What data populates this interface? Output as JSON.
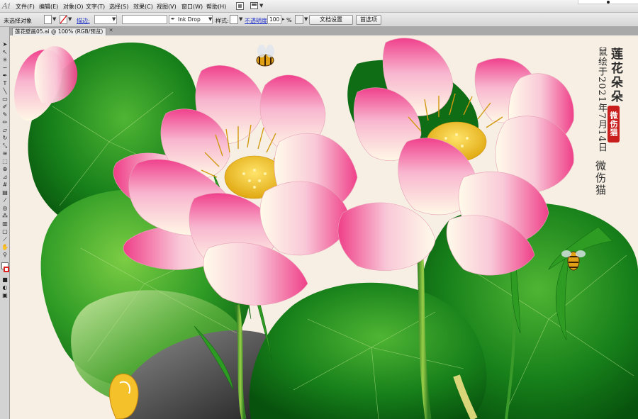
{
  "app": {
    "logo": "Ai"
  },
  "menu": [
    "文件(F)",
    "编辑(E)",
    "对象(O)",
    "文字(T)",
    "选择(S)",
    "效果(C)",
    "视图(V)",
    "窗口(W)",
    "帮助(H)"
  ],
  "control_bar": {
    "selection_status": "未选择对象",
    "stroke_label": "描边:",
    "brush_name": "Ink Drop",
    "style_label": "样式:",
    "opacity_label": "不透明度:",
    "opacity_value": "100",
    "opacity_unit": "%",
    "document_setup_button": "文档设置",
    "preferences_button": "首选项"
  },
  "document_tab": {
    "title": "莲花壁画05.ai @ 100% (RGB/预览)",
    "close": "✕"
  },
  "artwork": {
    "title": "莲花朵朵",
    "date_text": "鼠绘于2021年7月14日",
    "seal_text": "微伤猫",
    "artist": "微伤猫"
  },
  "colors": {
    "canvas": "#f7efe3",
    "leaf_dark": "#0c6b12",
    "leaf_light": "#8ed455",
    "petal_pink": "#f0458f",
    "stamen_gold": "#f0c020",
    "seal_red": "#c81e1e"
  }
}
